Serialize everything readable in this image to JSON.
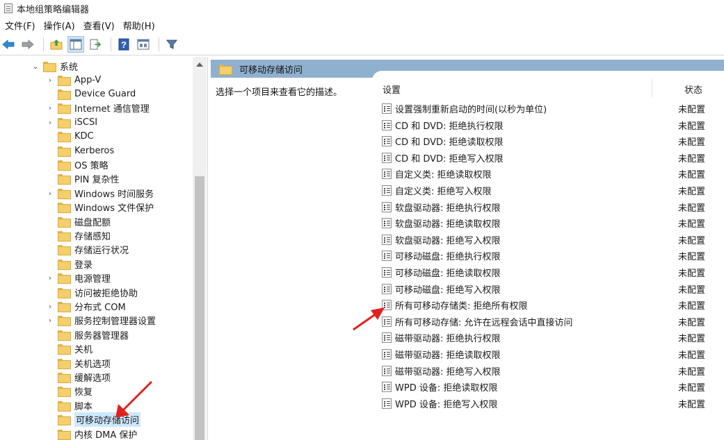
{
  "window": {
    "title": "本地组策略编辑器"
  },
  "menu": [
    "文件(F)",
    "操作(A)",
    "查看(V)",
    "帮助(H)"
  ],
  "toolbar": {
    "icons": [
      "back-arrow-icon",
      "forward-arrow-icon",
      "up-folder-icon",
      "show-hide-tree-icon",
      "export-list-icon",
      "help-icon",
      "properties-icon",
      "filter-icon"
    ]
  },
  "tree": {
    "parent": "系统",
    "items": [
      {
        "label": "App-V",
        "expandable": true
      },
      {
        "label": "Device Guard",
        "expandable": false
      },
      {
        "label": "Internet 通信管理",
        "expandable": true
      },
      {
        "label": "iSCSI",
        "expandable": true
      },
      {
        "label": "KDC",
        "expandable": false
      },
      {
        "label": "Kerberos",
        "expandable": false
      },
      {
        "label": "OS 策略",
        "expandable": false
      },
      {
        "label": "PIN 复杂性",
        "expandable": false
      },
      {
        "label": "Windows 时间服务",
        "expandable": true
      },
      {
        "label": "Windows 文件保护",
        "expandable": false
      },
      {
        "label": "磁盘配额",
        "expandable": false
      },
      {
        "label": "存储感知",
        "expandable": false
      },
      {
        "label": "存储运行状况",
        "expandable": false
      },
      {
        "label": "登录",
        "expandable": false
      },
      {
        "label": "电源管理",
        "expandable": true
      },
      {
        "label": "访问被拒绝协助",
        "expandable": false
      },
      {
        "label": "分布式 COM",
        "expandable": true
      },
      {
        "label": "服务控制管理器设置",
        "expandable": true
      },
      {
        "label": "服务器管理器",
        "expandable": false
      },
      {
        "label": "关机",
        "expandable": false
      },
      {
        "label": "关机选项",
        "expandable": false
      },
      {
        "label": "缓解选项",
        "expandable": false
      },
      {
        "label": "恢复",
        "expandable": false
      },
      {
        "label": "脚本",
        "expandable": false
      },
      {
        "label": "可移动存储访问",
        "expandable": false,
        "selected": true
      },
      {
        "label": "内核 DMA 保护",
        "expandable": false
      }
    ]
  },
  "right": {
    "header": "可移动存储访问",
    "description": "选择一个项目来查看它的描述。",
    "columns": {
      "setting": "设置",
      "state": "状态"
    },
    "rows": [
      {
        "name": "设置强制重新启动的时间(以秒为单位)",
        "state": "未配置"
      },
      {
        "name": "CD 和 DVD: 拒绝执行权限",
        "state": "未配置"
      },
      {
        "name": "CD 和 DVD: 拒绝读取权限",
        "state": "未配置"
      },
      {
        "name": "CD 和 DVD: 拒绝写入权限",
        "state": "未配置"
      },
      {
        "name": "自定义类: 拒绝读取权限",
        "state": "未配置"
      },
      {
        "name": "自定义类: 拒绝写入权限",
        "state": "未配置"
      },
      {
        "name": "软盘驱动器: 拒绝执行权限",
        "state": "未配置"
      },
      {
        "name": "软盘驱动器: 拒绝读取权限",
        "state": "未配置"
      },
      {
        "name": "软盘驱动器: 拒绝写入权限",
        "state": "未配置"
      },
      {
        "name": "可移动磁盘: 拒绝执行权限",
        "state": "未配置"
      },
      {
        "name": "可移动磁盘: 拒绝读取权限",
        "state": "未配置"
      },
      {
        "name": "可移动磁盘: 拒绝写入权限",
        "state": "未配置"
      },
      {
        "name": "所有可移动存储类: 拒绝所有权限",
        "state": "未配置"
      },
      {
        "name": "所有可移动存储: 允许在远程会话中直接访问",
        "state": "未配置"
      },
      {
        "name": "磁带驱动器: 拒绝执行权限",
        "state": "未配置"
      },
      {
        "name": "磁带驱动器: 拒绝读取权限",
        "state": "未配置"
      },
      {
        "name": "磁带驱动器: 拒绝写入权限",
        "state": "未配置"
      },
      {
        "name": "WPD 设备: 拒绝读取权限",
        "state": "未配置"
      },
      {
        "name": "WPD 设备: 拒绝写入权限",
        "state": "未配置"
      }
    ]
  },
  "colors": {
    "accent_header": "#90b0cf",
    "selection": "#cce8ff",
    "annotation_arrow": "#e02020",
    "folder": "#f4cf6b"
  }
}
